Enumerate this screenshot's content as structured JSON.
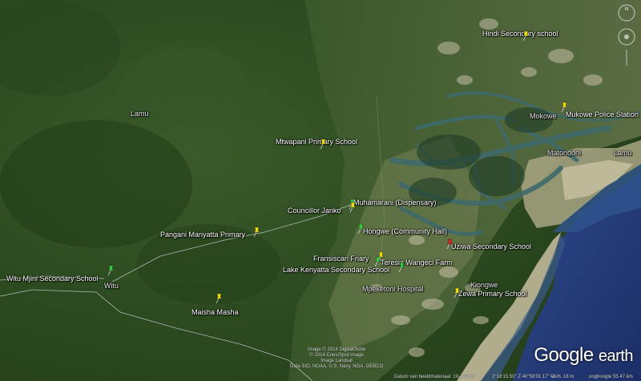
{
  "colors": {
    "land_dark": "#2c4a20",
    "land_mid": "#4a6a38",
    "land_light": "#7c8f5c",
    "sand": "#c9c0a0",
    "sea": "#27407e",
    "sea_deep": "#1c2e66",
    "channel": "#3f6a6a",
    "pin_yellow": "#f4e200",
    "pin_green": "#2fd23a",
    "pin_red": "#e0201a"
  },
  "places": [
    {
      "name": "Lamu"
    },
    {
      "name": "Lamu"
    },
    {
      "name": "Matondoni"
    },
    {
      "name": "Witu"
    },
    {
      "name": "Mokowe"
    },
    {
      "name": "Kiongwe"
    },
    {
      "name": "Mpeketoni Hospital"
    }
  ],
  "markers": [
    {
      "label": "Hindi Secondary school",
      "color": "yellow"
    },
    {
      "label": "Mukowe Police Station",
      "color": "yellow"
    },
    {
      "label": "Mtwapani Primary School",
      "color": "yellow"
    },
    {
      "label": "Muhamarani (Dispensary)",
      "color": "green"
    },
    {
      "label": "Councillor Janko",
      "color": "yellow"
    },
    {
      "label": "Hongwe (Community Hall)",
      "color": "green"
    },
    {
      "label": "Pangani Manyatta Primary",
      "color": "yellow"
    },
    {
      "label": "Uziwa Secondary School",
      "color": "red"
    },
    {
      "label": "Fransiscan Friary",
      "color": "yellow"
    },
    {
      "label": "Teresia Wangeci Farm",
      "color": "green"
    },
    {
      "label": "Lake Kenyatta Secondary School",
      "color": "green"
    },
    {
      "label": "Witu Mjini Secondary School",
      "color": "green"
    },
    {
      "label": "Maisha Masha",
      "color": "yellow"
    },
    {
      "label": "Zewa Primary School",
      "color": "yellow"
    }
  ],
  "credits": {
    "line1": "Image © 2014 DigitalGlobe",
    "line2": "© 2014 Cnes/Spot Image",
    "line3": "Image Landsat",
    "line4": "Data SIO, NOAA, U.S. Navy, NGA, GEBCO"
  },
  "status": {
    "date": "Datum van beeldmateriaal: 10-4-2013",
    "coords": "2°18'15.50\" Z   40°58'01.17\" O",
    "elev": "verh.   18 m",
    "eye": "ooghoogte  55.47 km"
  },
  "logo": {
    "google": "Google",
    "earth": "earth"
  }
}
